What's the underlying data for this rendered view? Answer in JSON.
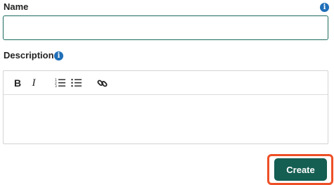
{
  "form": {
    "name_label": "Name",
    "name_value": "",
    "description_label": "Description",
    "info_glyph": "i"
  },
  "toolbar": {
    "bold_glyph": "B",
    "italic_glyph": "I"
  },
  "icons": {
    "info": "info-icon",
    "bold": "bold-icon",
    "italic": "italic-icon",
    "ordered_list": "ordered-list-icon",
    "bullet_list": "bullet-list-icon",
    "link": "link-icon"
  },
  "actions": {
    "create_label": "Create"
  },
  "colors": {
    "accent": "#155e52",
    "input_border": "#1d6b5f",
    "info": "#1f6fb8",
    "highlight": "#ee4f26"
  }
}
